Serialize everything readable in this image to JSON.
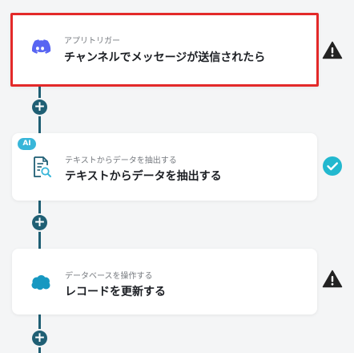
{
  "flow": {
    "steps": [
      {
        "name": "discord-trigger",
        "category": "アプリトリガー",
        "title": "チャンネルでメッセージが送信されたら",
        "icon": "discord-icon",
        "status": "warning",
        "selected": true
      },
      {
        "name": "ai-extract-text",
        "badge": "AI",
        "category": "テキストからデータを抽出する",
        "title": "テキストからデータを抽出する",
        "icon": "document-search-icon",
        "status": "complete"
      },
      {
        "name": "salesforce-update",
        "category": "データベースを操作する",
        "title": "レコードを更新する",
        "icon": "salesforce-cloud-icon",
        "status": "warning"
      }
    ],
    "add_step_symbol": "+"
  },
  "colors": {
    "connector": "#1f5f74",
    "selected_border": "#e32929",
    "discord": "#5865f2",
    "salesforce": "#1798c1",
    "complete": "#22b8cf",
    "warning": "#222222",
    "ai_badge": "#38b6d9"
  }
}
